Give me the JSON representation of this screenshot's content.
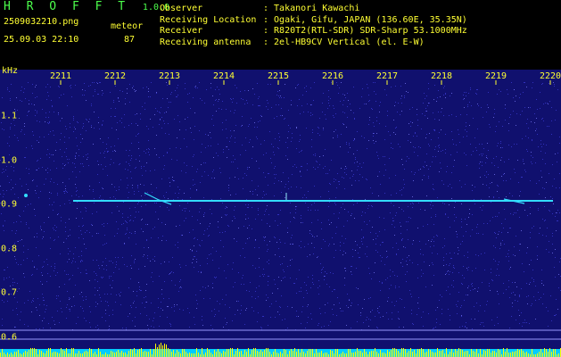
{
  "app": {
    "name": "H R O F F T",
    "version": "1.0.0"
  },
  "file": {
    "name": "2509032210.png",
    "timestamp": "25.09.03 22:10"
  },
  "detection": {
    "label": "meteor",
    "count": "87"
  },
  "station": [
    {
      "key": "Observer",
      "value": ": Takanori Kawachi"
    },
    {
      "key": "Receiving Location",
      "value": ": Ogaki, Gifu, JAPAN (136.60E, 35.35N)"
    },
    {
      "key": "Receiver",
      "value": ": R820T2(RTL-SDR) SDR-Sharp 53.1000MHz"
    },
    {
      "key": "Receiving antenna",
      "value": ": 2el-HB9CV Vertical (el. E-W)"
    }
  ],
  "axis": {
    "y_unit": "kHz",
    "x_ticks": [
      "2211",
      "2212",
      "2213",
      "2214",
      "2215",
      "2216",
      "2217",
      "2218",
      "2219",
      "2220"
    ],
    "y_ticks": [
      "1.1",
      "1.0",
      "0.9",
      "0.8",
      "0.7",
      "0.6"
    ]
  },
  "colors": {
    "background": "#000000",
    "waterfall": "#10106e",
    "text": "#ffff33",
    "brand": "#4cff4c",
    "trace": "#33ddff",
    "spectrum": "#00ccff",
    "peaks": "#ffff00"
  }
}
